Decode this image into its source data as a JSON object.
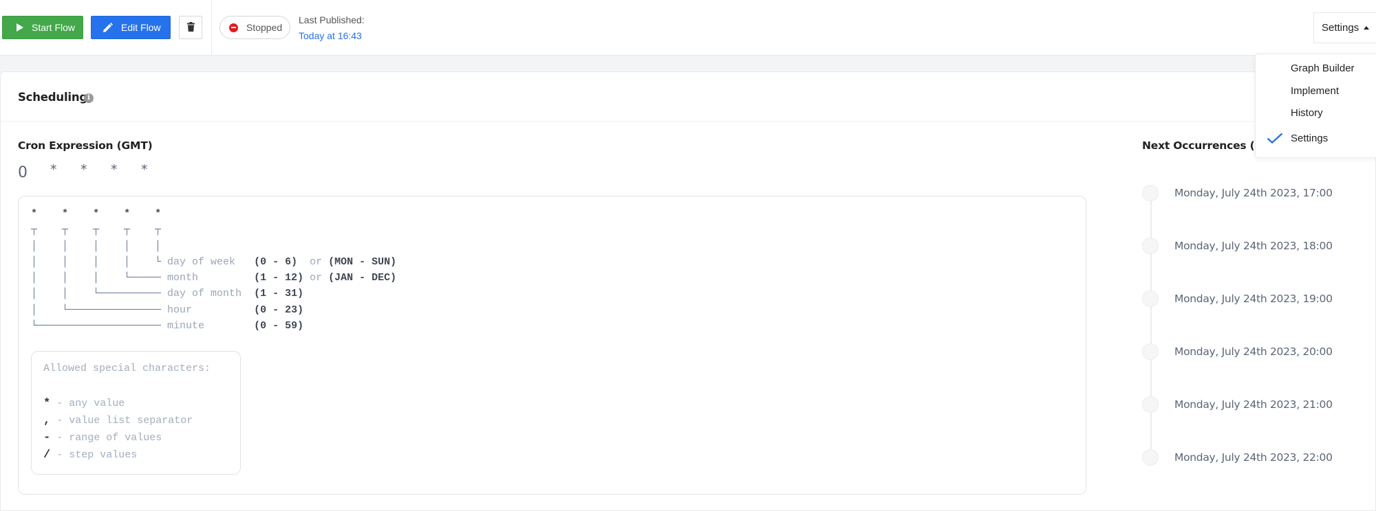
{
  "toolbar": {
    "start_label": "Start Flow",
    "edit_label": "Edit Flow",
    "delete_icon": "trash-icon",
    "status": "Stopped",
    "status_color": "#e21b1b",
    "last_published_label": "Last Published:",
    "last_published_value": "Today at 16:43",
    "settings_label": "Settings"
  },
  "colors": {
    "start": "#43a84a",
    "edit": "#2672ec",
    "link": "#2672ec",
    "check": "#2672ec"
  },
  "menu": {
    "items": [
      {
        "label": "Graph Builder",
        "checked": false
      },
      {
        "label": "Implement",
        "checked": false
      },
      {
        "label": "History",
        "checked": false
      },
      {
        "label": "Settings",
        "checked": true
      }
    ]
  },
  "scheduling": {
    "title": "Scheduling",
    "cron_label": "Cron Expression (GMT)",
    "cron_fields": [
      "0",
      "*",
      "*",
      "*",
      "*"
    ],
    "diagram": {
      "stars": [
        "*",
        "*",
        "*",
        "*",
        "*"
      ],
      "fields": [
        {
          "name": "day of week",
          "range": "(0 - 6)",
          "or": "or",
          "alt": "(MON - SUN)"
        },
        {
          "name": "month",
          "range": "(1 - 12)",
          "or": "or",
          "alt": "(JAN - DEC)"
        },
        {
          "name": "day of month",
          "range": "(1 - 31)",
          "or": "",
          "alt": ""
        },
        {
          "name": "hour",
          "range": "(0 - 23)",
          "or": "",
          "alt": ""
        },
        {
          "name": "minute",
          "range": "(0 - 59)",
          "or": "",
          "alt": ""
        }
      ]
    },
    "allowed": {
      "title": "Allowed special characters:",
      "items": [
        {
          "char": "*",
          "desc": "- any value"
        },
        {
          "char": ",",
          "desc": "- value list separator"
        },
        {
          "char": "-",
          "desc": "- range of values"
        },
        {
          "char": "/",
          "desc": "- step values"
        }
      ]
    }
  },
  "occurrences": {
    "title": "Next Occurrences (Local)",
    "items": [
      "Monday, July 24th 2023, 17:00",
      "Monday, July 24th 2023, 18:00",
      "Monday, July 24th 2023, 19:00",
      "Monday, July 24th 2023, 20:00",
      "Monday, July 24th 2023, 21:00",
      "Monday, July 24th 2023, 22:00"
    ]
  }
}
